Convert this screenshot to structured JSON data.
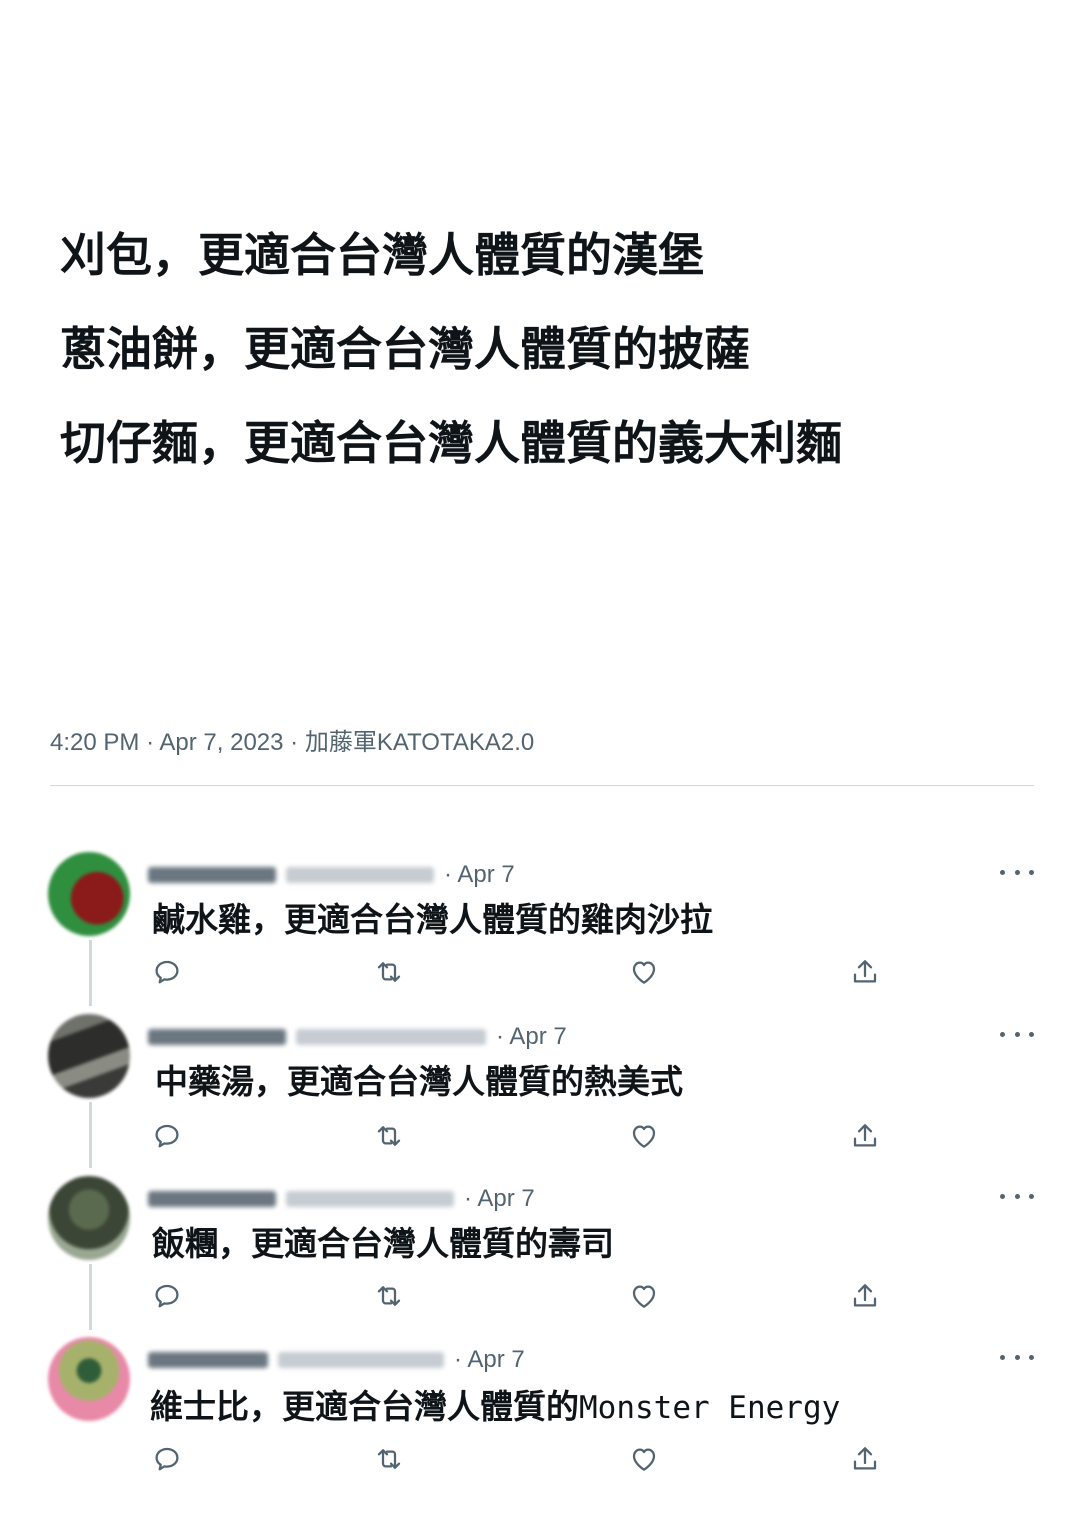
{
  "tweet": {
    "lines": [
      "刈包，更適合台灣人體質的漢堡",
      "蔥油餅，更適合台灣人體質的披薩",
      "切仔麵，更適合台灣人體質的義大利麵"
    ],
    "time": "4:20 PM",
    "date": "Apr 7, 2023",
    "source": "加藤軍KATOTAKA2.0"
  },
  "replies": [
    {
      "date": "· Apr 7",
      "text": "鹹水雞，更適合台灣人體質的雞肉沙拉",
      "avatar_colors": [
        "#8b1a1a",
        "#2f8f3f"
      ]
    },
    {
      "date": "· Apr 7",
      "text": "中藥湯，更適合台灣人體質的熱美式",
      "avatar_colors": [
        "#3a3a38",
        "#7d7f78"
      ]
    },
    {
      "date": "· Apr 7",
      "text": "飯糰，更適合台灣人體質的壽司",
      "avatar_colors": [
        "#3c4636",
        "#7b8b74"
      ]
    },
    {
      "date": "· Apr 7",
      "text_cjk": "維士比，更適合台灣人體質的",
      "text_latin": "Monster Energy",
      "avatar_colors": [
        "#e889a8",
        "#6b8c4f"
      ]
    }
  ],
  "icons": {
    "reply": "reply-bubble-icon",
    "retweet": "retweet-icon",
    "like": "heart-icon",
    "share": "share-upload-icon",
    "more": "more-dots-icon"
  },
  "colors": {
    "text": "#0f1419",
    "secondary": "#536471",
    "divider": "#cfd9de"
  }
}
